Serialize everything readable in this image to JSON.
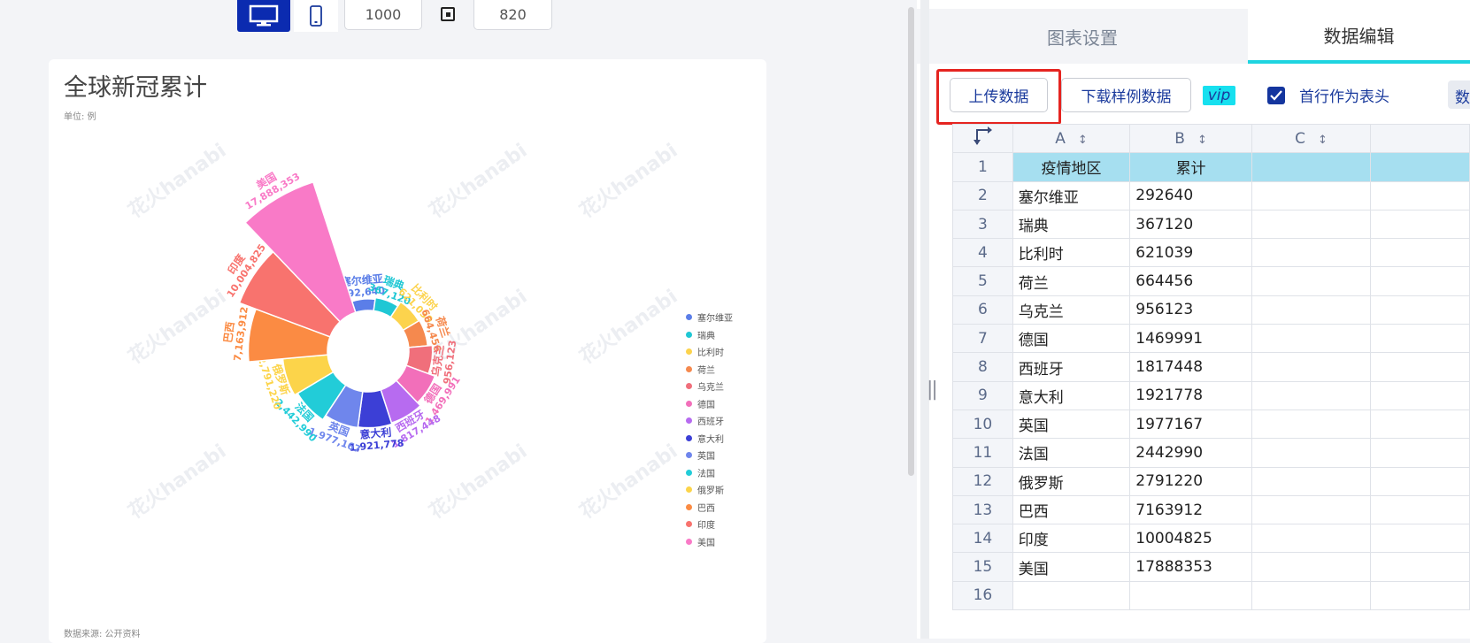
{
  "preview": {
    "width_value": "1000",
    "height_value": "820"
  },
  "chart": {
    "title": "全球新冠累计",
    "unit": "单位: 例",
    "source": "数据来源: 公开资料",
    "watermark": "花火hanabi"
  },
  "chart_data": {
    "type": "rose",
    "categories": [
      "塞尔维亚",
      "瑞典",
      "比利时",
      "荷兰",
      "乌克兰",
      "德国",
      "西班牙",
      "意大利",
      "英国",
      "法国",
      "俄罗斯",
      "巴西",
      "印度",
      "美国"
    ],
    "values": [
      292640,
      367120,
      621039,
      664456,
      956123,
      1469991,
      1817448,
      1921778,
      1977167,
      2442990,
      2791220,
      7163912,
      10004825,
      17888353
    ],
    "value_labels": [
      "292,640",
      "367,120",
      "621,039",
      "664,456",
      "956,123",
      "1,469,991",
      "1,817,448",
      "1,921,778",
      "1,977,167",
      "2,442,990",
      "2,791,220",
      "7,163,912",
      "10,004,825",
      "17,888,353"
    ],
    "colors": [
      "#5b7ee8",
      "#1fc7d4",
      "#fcd34d",
      "#f5894e",
      "#f06f7b",
      "#f26fba",
      "#b76bf0",
      "#3c3fd6",
      "#6f86ec",
      "#22ccd8",
      "#fcd44a",
      "#fb8b43",
      "#f8736e",
      "#f97ac7"
    ],
    "legend": "right"
  },
  "tabs": {
    "settings": "图表设置",
    "data": "数据编辑"
  },
  "toolbar": {
    "upload": "上传数据",
    "sample": "下载样例数据",
    "vip": "vip",
    "header_row": "首行作为表头",
    "more": "数"
  },
  "sheet": {
    "columns": [
      "A",
      "B",
      "C"
    ],
    "sort_glyph": "↕",
    "rows": [
      [
        "疫情地区",
        "累计"
      ],
      [
        "塞尔维亚",
        "292640"
      ],
      [
        "瑞典",
        "367120"
      ],
      [
        "比利时",
        "621039"
      ],
      [
        "荷兰",
        "664456"
      ],
      [
        "乌克兰",
        "956123"
      ],
      [
        "德国",
        "1469991"
      ],
      [
        "西班牙",
        "1817448"
      ],
      [
        "意大利",
        "1921778"
      ],
      [
        "英国",
        "1977167"
      ],
      [
        "法国",
        "2442990"
      ],
      [
        "俄罗斯",
        "2791220"
      ],
      [
        "巴西",
        "7163912"
      ],
      [
        "印度",
        "10004825"
      ],
      [
        "美国",
        "17888353"
      ],
      [
        "",
        ""
      ]
    ]
  }
}
